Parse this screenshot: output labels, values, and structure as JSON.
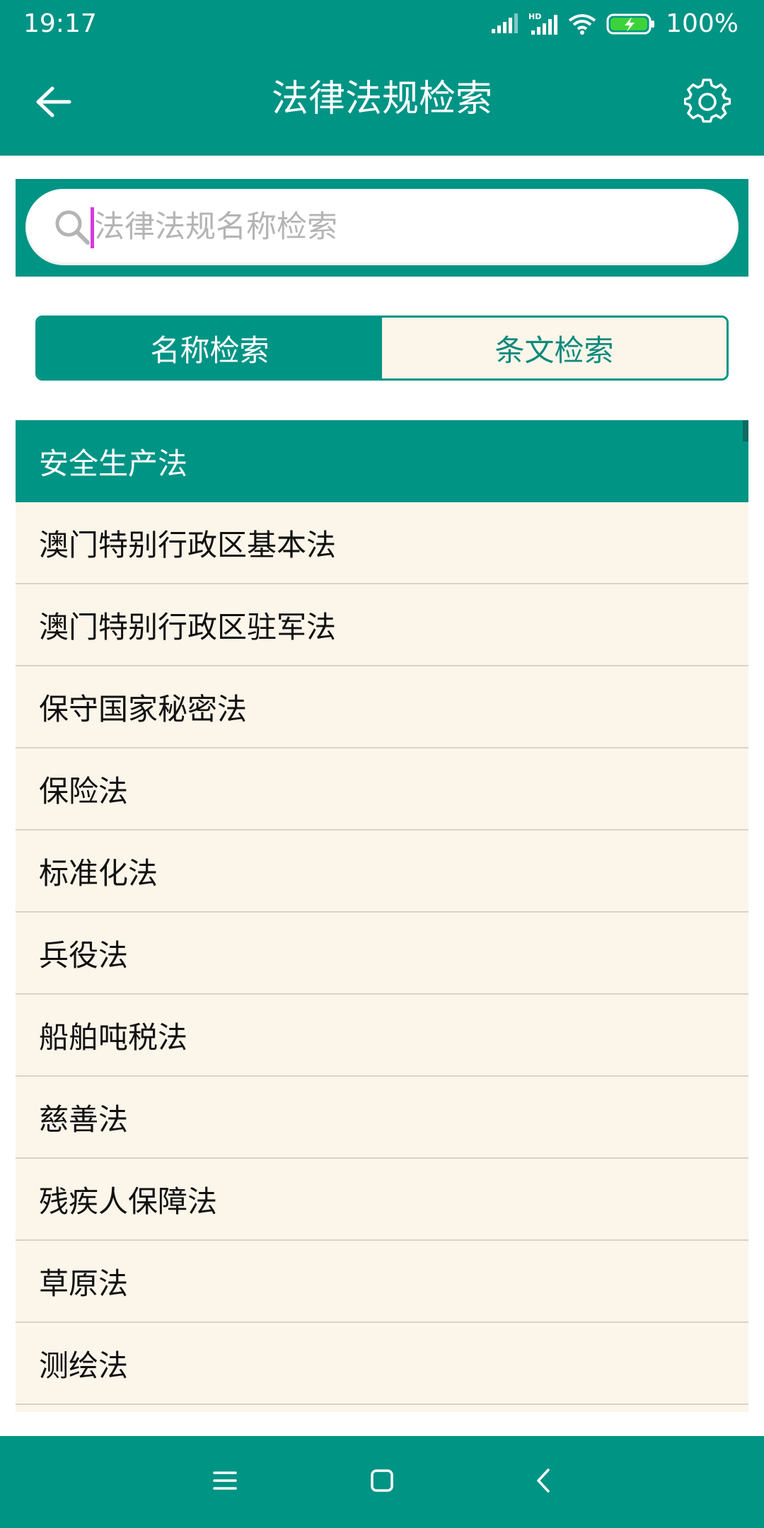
{
  "status_bar": {
    "time": "19:17",
    "battery": "100%"
  },
  "app_bar": {
    "title": "法律法规检索"
  },
  "search": {
    "placeholder": "法律法规名称检索",
    "value": ""
  },
  "tabs": {
    "name_search": "名称检索",
    "article_search": "条文检索"
  },
  "list": {
    "section_header": "安全生产法",
    "items": [
      "澳门特别行政区基本法",
      "澳门特别行政区驻军法",
      "保守国家秘密法",
      "保险法",
      "标准化法",
      "兵役法",
      "船舶吨税法",
      "慈善法",
      "残疾人保障法",
      "草原法",
      "测绘法"
    ]
  },
  "colors": {
    "primary": "#009485",
    "list_background": "#fcf5ea",
    "cursor": "#d43adf"
  },
  "icons": {
    "back": "arrow-left-icon",
    "settings": "gear-icon",
    "search": "search-icon",
    "nav_menu": "menu-icon",
    "nav_home": "square-home-icon",
    "nav_back": "chevron-left-icon"
  }
}
